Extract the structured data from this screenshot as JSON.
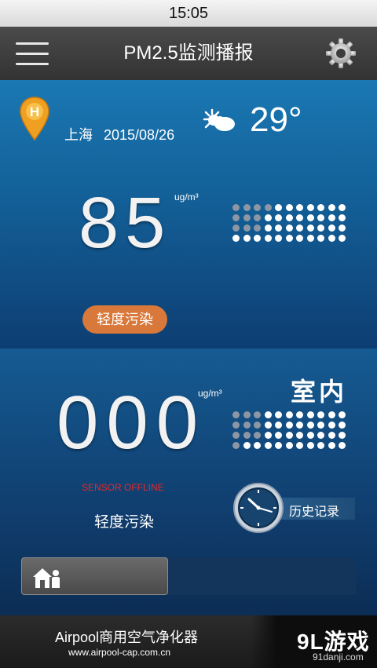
{
  "status_bar": {
    "time": "15:05"
  },
  "header": {
    "title": "PM2.5监测播报"
  },
  "outdoor": {
    "pin_letter": "H",
    "city": "上海",
    "date": "2015/08/26",
    "temperature": "29°",
    "pm_value": "85",
    "unit": "ug/m³",
    "level_label": "轻度污染",
    "dots": {
      "columns": 11,
      "rows": 4,
      "dim_pattern": [
        4,
        3,
        3,
        0
      ]
    }
  },
  "indoor": {
    "room_label": "室内",
    "pm_value": "000",
    "unit": "ug/m³",
    "sensor_status": "SENSOR OFFLINE",
    "level_label": "轻度污染",
    "history_label": "历史记录",
    "progress": 0.44,
    "dots": {
      "columns": 11,
      "rows": 4,
      "dim_pattern": [
        3,
        3,
        3,
        1
      ]
    }
  },
  "footer": {
    "product_name": "Airpool商用空气净化器",
    "url": "www.airpool-cap.com.cn"
  },
  "watermark": {
    "main": "9L游戏",
    "sub": "91danji.com"
  },
  "colors": {
    "badge": "#d8783a",
    "sensor_status": "#e02a2a",
    "dot_on": "#ffffff",
    "dot_dim": "#8c96a4"
  }
}
